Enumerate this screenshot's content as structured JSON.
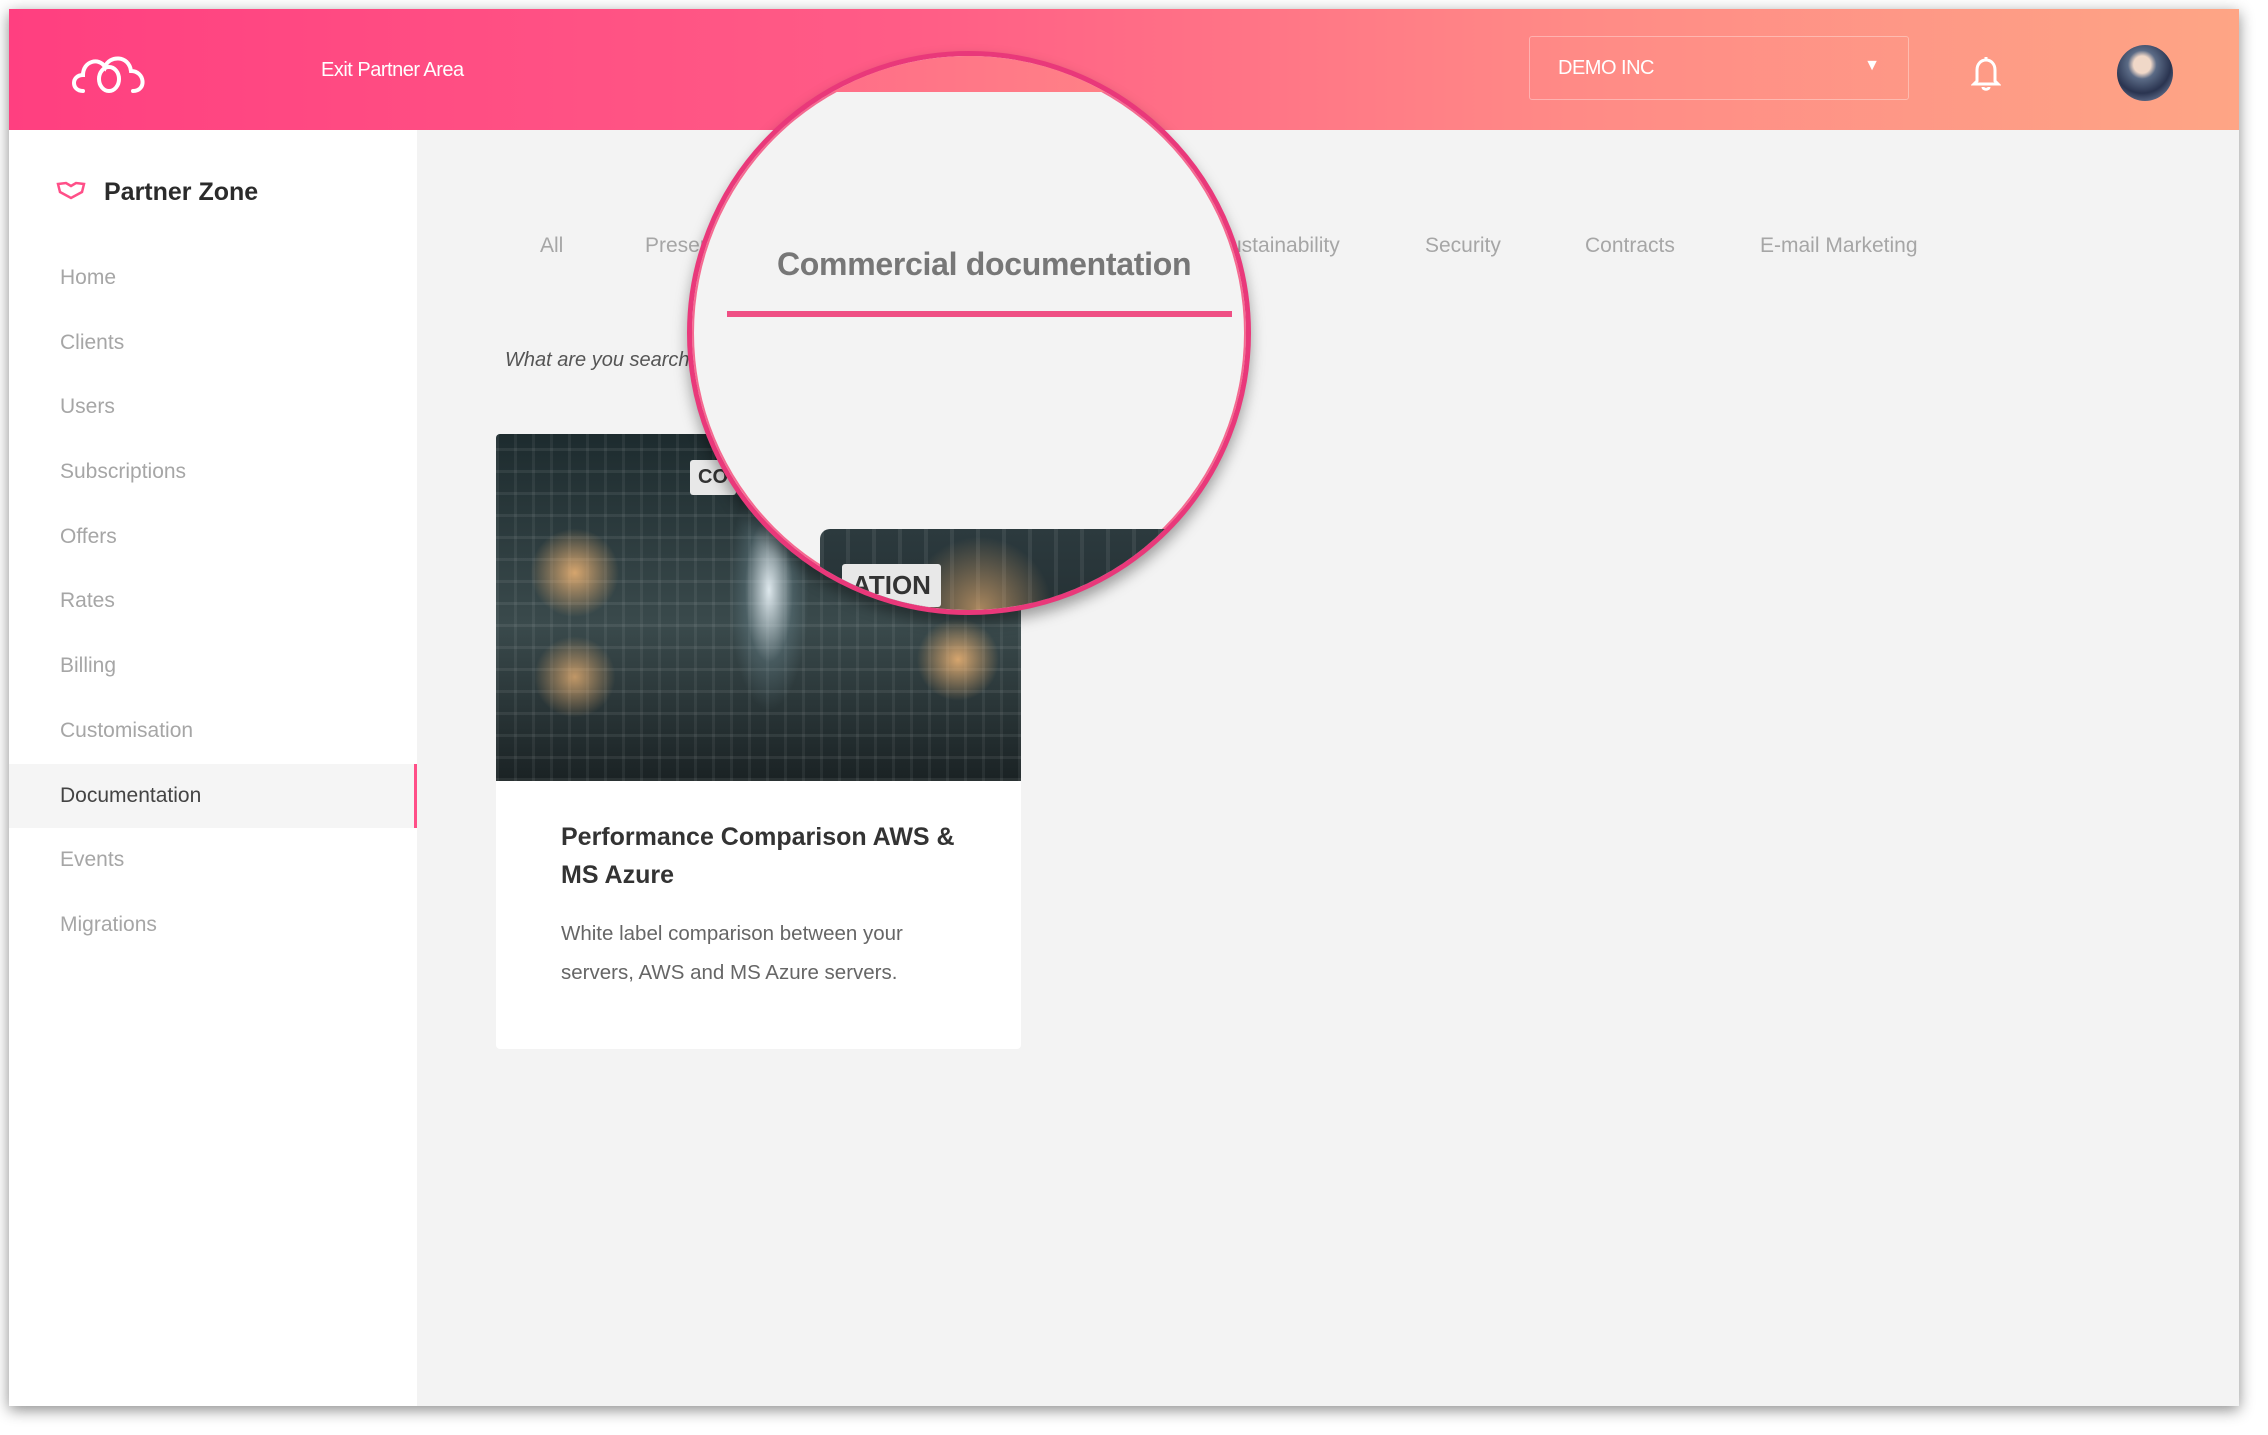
{
  "header": {
    "exit_label": "Exit Partner Area",
    "org_select": {
      "value": "DEMO INC"
    },
    "icons": [
      "cloud-logo-icon",
      "bell-icon",
      "avatar"
    ]
  },
  "sidebar": {
    "title": "Partner Zone",
    "items": [
      {
        "label": "Home"
      },
      {
        "label": "Clients"
      },
      {
        "label": "Users"
      },
      {
        "label": "Subscriptions"
      },
      {
        "label": "Offers"
      },
      {
        "label": "Rates"
      },
      {
        "label": "Billing"
      },
      {
        "label": "Customisation"
      },
      {
        "label": "Documentation",
        "active": true
      },
      {
        "label": "Events"
      },
      {
        "label": "Migrations"
      }
    ]
  },
  "tabs": [
    {
      "label": "All"
    },
    {
      "label": "Presentations"
    },
    {
      "label": "Sustainability"
    },
    {
      "label": "Security"
    },
    {
      "label": "Contracts"
    },
    {
      "label": "E-mail Marketing"
    }
  ],
  "magnifier": {
    "active_tab": "Commercial documentation",
    "image_label": "ATION"
  },
  "search": {
    "placeholder": "What are you searching for?"
  },
  "card": {
    "image_label": "CO",
    "title": "Performance Comparison AWS & MS Azure",
    "description": "White label comparison between your servers, AWS and MS Azure servers."
  },
  "colors": {
    "accent": "#ff4f88",
    "header_start": "#ff3f80",
    "header_end": "#fea585"
  }
}
